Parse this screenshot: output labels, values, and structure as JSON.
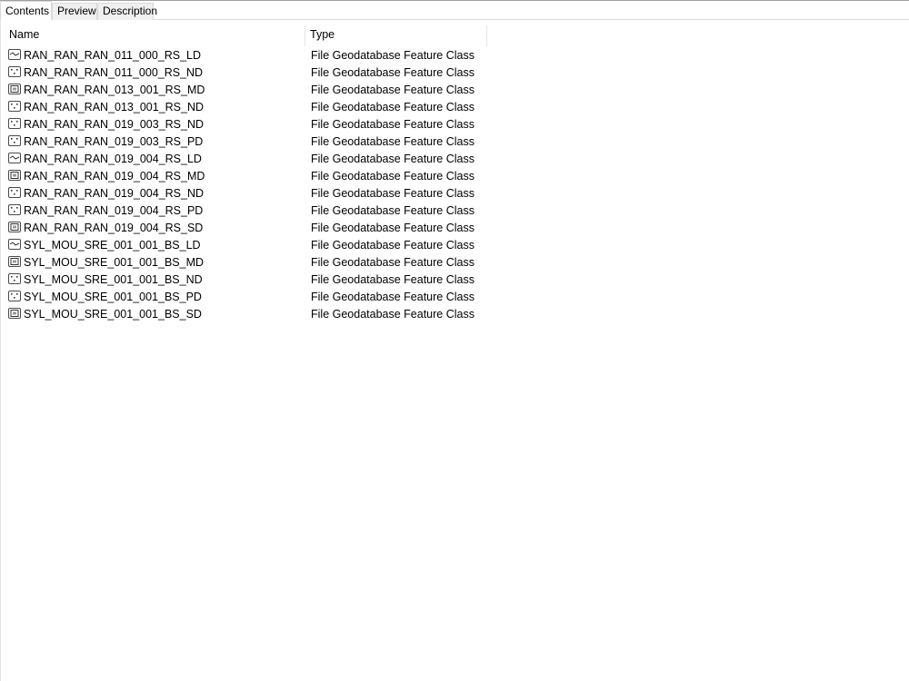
{
  "tabs": [
    {
      "label": "Contents",
      "active": true
    },
    {
      "label": "Preview",
      "active": false
    },
    {
      "label": "Description",
      "active": false
    }
  ],
  "columns": {
    "name": "Name",
    "type": "Type"
  },
  "rows": [
    {
      "name": "RAN_RAN_RAN_011_000_RS_LD",
      "type": "File Geodatabase Feature Class",
      "icon": "line-feature-class-icon"
    },
    {
      "name": "RAN_RAN_RAN_011_000_RS_ND",
      "type": "File Geodatabase Feature Class",
      "icon": "point-feature-class-icon"
    },
    {
      "name": "RAN_RAN_RAN_013_001_RS_MD",
      "type": "File Geodatabase Feature Class",
      "icon": "polygon-feature-class-icon"
    },
    {
      "name": "RAN_RAN_RAN_013_001_RS_ND",
      "type": "File Geodatabase Feature Class",
      "icon": "point-feature-class-icon"
    },
    {
      "name": "RAN_RAN_RAN_019_003_RS_ND",
      "type": "File Geodatabase Feature Class",
      "icon": "point-feature-class-icon"
    },
    {
      "name": "RAN_RAN_RAN_019_003_RS_PD",
      "type": "File Geodatabase Feature Class",
      "icon": "point-feature-class-icon"
    },
    {
      "name": "RAN_RAN_RAN_019_004_RS_LD",
      "type": "File Geodatabase Feature Class",
      "icon": "line-feature-class-icon"
    },
    {
      "name": "RAN_RAN_RAN_019_004_RS_MD",
      "type": "File Geodatabase Feature Class",
      "icon": "polygon-feature-class-icon"
    },
    {
      "name": "RAN_RAN_RAN_019_004_RS_ND",
      "type": "File Geodatabase Feature Class",
      "icon": "point-feature-class-icon"
    },
    {
      "name": "RAN_RAN_RAN_019_004_RS_PD",
      "type": "File Geodatabase Feature Class",
      "icon": "point-feature-class-icon"
    },
    {
      "name": "RAN_RAN_RAN_019_004_RS_SD",
      "type": "File Geodatabase Feature Class",
      "icon": "polygon-feature-class-icon"
    },
    {
      "name": "SYL_MOU_SRE_001_001_BS_LD",
      "type": "File Geodatabase Feature Class",
      "icon": "line-feature-class-icon"
    },
    {
      "name": "SYL_MOU_SRE_001_001_BS_MD",
      "type": "File Geodatabase Feature Class",
      "icon": "polygon-feature-class-icon"
    },
    {
      "name": "SYL_MOU_SRE_001_001_BS_ND",
      "type": "File Geodatabase Feature Class",
      "icon": "point-feature-class-icon"
    },
    {
      "name": "SYL_MOU_SRE_001_001_BS_PD",
      "type": "File Geodatabase Feature Class",
      "icon": "point-feature-class-icon"
    },
    {
      "name": "SYL_MOU_SRE_001_001_BS_SD",
      "type": "File Geodatabase Feature Class",
      "icon": "polygon-feature-class-icon"
    }
  ]
}
